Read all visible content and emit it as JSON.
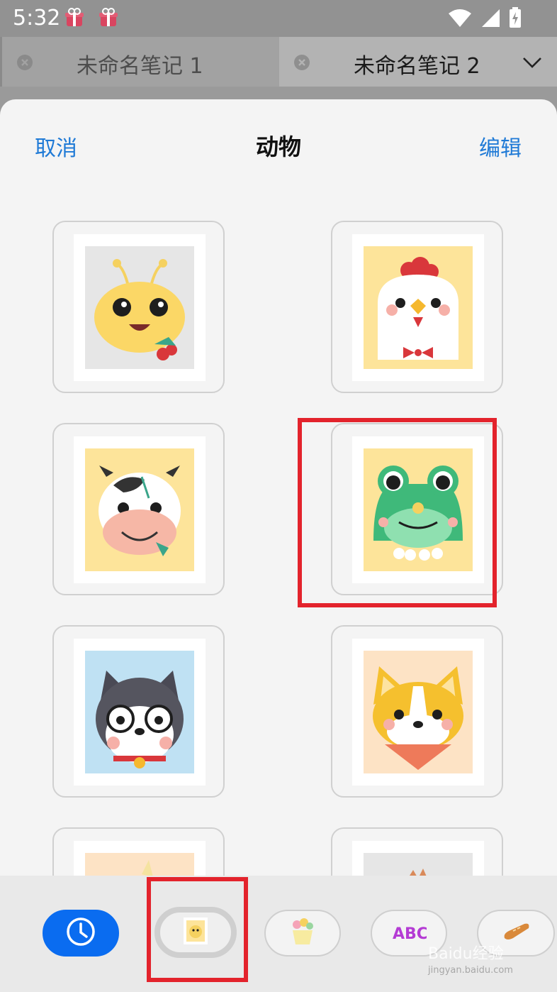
{
  "status_bar": {
    "time": "5:32"
  },
  "tabs": [
    {
      "title": "未命名笔记 1",
      "active": false
    },
    {
      "title": "未命名笔记 2",
      "active": true
    }
  ],
  "sheet": {
    "cancel_label": "取消",
    "title": "动物",
    "edit_label": "编辑"
  },
  "stickers": [
    {
      "name": "bee-sticker",
      "background": "#e6e6e6"
    },
    {
      "name": "chicken-sticker",
      "background": "#fde49a"
    },
    {
      "name": "cow-sticker",
      "background": "#fde49a"
    },
    {
      "name": "frog-sticker",
      "background": "#fde49a",
      "highlighted": true
    },
    {
      "name": "husky-sticker",
      "background": "#bfe1f3"
    },
    {
      "name": "corgi-sticker",
      "background": "#fde3c5"
    }
  ],
  "category_tabs": [
    {
      "name": "recent-category-tab",
      "icon": "clock-icon",
      "active": true
    },
    {
      "name": "animals-category-tab",
      "icon": "animal-sticker-thumb-icon",
      "selected": true,
      "highlighted": true
    },
    {
      "name": "plants-category-tab",
      "icon": "flower-cup-icon"
    },
    {
      "name": "letters-category-tab",
      "icon": "abc-letters-icon"
    },
    {
      "name": "food-category-tab",
      "icon": "bread-icon"
    }
  ],
  "icon_letters": "ABC",
  "watermark": {
    "brand": "Baidu经验",
    "url": "jingyan.baidu.com"
  },
  "colors": {
    "accent_blue": "#1f7ad6",
    "active_tab_blue": "#0a6cf0",
    "highlight_red": "#e3232c"
  }
}
